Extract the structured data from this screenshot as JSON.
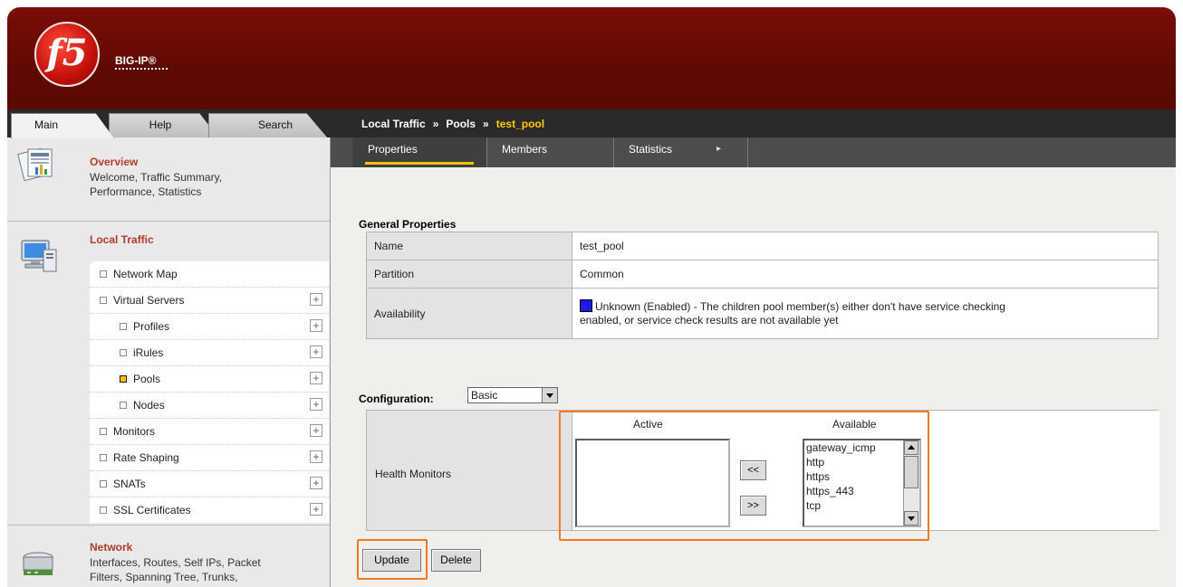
{
  "header": {
    "logo_text": "f5",
    "product": "BIG-IP®"
  },
  "nav_tabs": [
    {
      "label": "Main"
    },
    {
      "label": "Help"
    },
    {
      "label": "Search"
    }
  ],
  "breadcrumb": {
    "part1": "Local Traffic",
    "sep": "»",
    "part2": "Pools",
    "current": "test_pool"
  },
  "sidebar": {
    "overview": {
      "title": "Overview",
      "desc_line1": "Welcome, Traffic Summary,",
      "desc_line2": "Performance, Statistics"
    },
    "local_traffic": {
      "title": "Local Traffic"
    },
    "menu": [
      {
        "label": "Network Map"
      },
      {
        "label": "Virtual Servers"
      },
      {
        "label": "Profiles"
      },
      {
        "label": "iRules"
      },
      {
        "label": "Pools",
        "selected": true
      },
      {
        "label": "Nodes"
      },
      {
        "label": "Monitors"
      },
      {
        "label": "Rate Shaping"
      },
      {
        "label": "SNATs"
      },
      {
        "label": "SSL Certificates"
      }
    ],
    "network": {
      "title": "Network",
      "desc_line1": "Interfaces, Routes, Self IPs, Packet",
      "desc_line2": "Filters, Spanning Tree, Trunks,"
    }
  },
  "subtabs": [
    {
      "label": "Properties"
    },
    {
      "label": "Members"
    },
    {
      "label": "Statistics"
    }
  ],
  "general": {
    "title": "General Properties",
    "rows": [
      {
        "label": "Name",
        "value": "test_pool"
      },
      {
        "label": "Partition",
        "value": "Common"
      },
      {
        "label": "Availability",
        "value_line1": "Unknown (Enabled) - The children pool member(s) either don't have service checking",
        "value_line2": "enabled, or service check results are not available yet",
        "status_color": "#2018e8"
      }
    ]
  },
  "configuration": {
    "title": "Configuration:",
    "selected": "Basic"
  },
  "health_monitors": {
    "label": "Health Monitors",
    "active_header": "Active",
    "available_header": "Available",
    "active": [],
    "available": [
      "gateway_icmp",
      "http",
      "https",
      "https_443",
      "tcp"
    ],
    "move_left": "<<",
    "move_right": ">>"
  },
  "actions": {
    "update": "Update",
    "delete": "Delete"
  },
  "colors": {
    "banner": "#6a0b04",
    "accent": "#f6c200",
    "highlight": "#f07a1d",
    "section_title": "#b23b2a"
  }
}
